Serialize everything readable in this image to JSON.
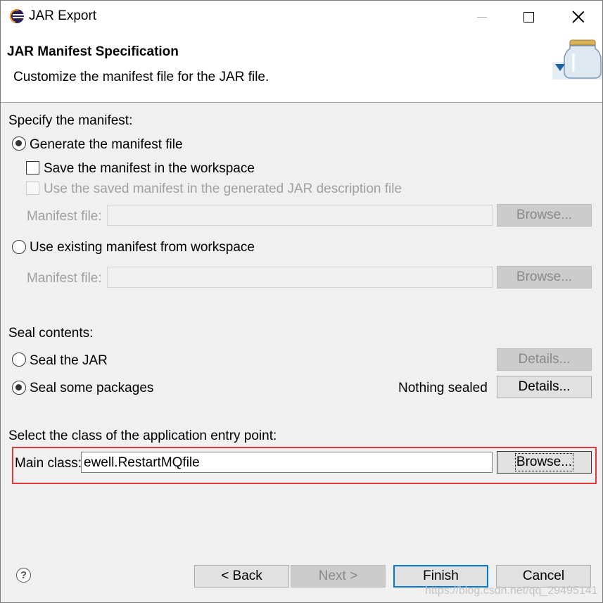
{
  "window": {
    "title": "JAR Export"
  },
  "banner": {
    "title": "JAR Manifest Specification",
    "description": "Customize the manifest file for the JAR file."
  },
  "manifest": {
    "section_label": "Specify the manifest:",
    "generate_label": "Generate the manifest file",
    "generate_checked": true,
    "save_label": "Save the manifest in the workspace",
    "save_checked": false,
    "use_saved_label": "Use the saved manifest in the generated JAR description file",
    "use_saved_enabled": false,
    "manifest_file_label": "Manifest file:",
    "manifest_file_value": "",
    "browse_label": "Browse...",
    "use_existing_label": "Use existing manifest from workspace",
    "use_existing_checked": false,
    "existing_manifest_file_label": "Manifest file:",
    "existing_manifest_file_value": "",
    "existing_browse_label": "Browse..."
  },
  "seal": {
    "section_label": "Seal contents:",
    "seal_jar_label": "Seal the JAR",
    "seal_jar_checked": false,
    "seal_jar_details_label": "Details...",
    "seal_some_label": "Seal some packages",
    "seal_some_checked": true,
    "status_text": "Nothing sealed",
    "seal_some_details_label": "Details..."
  },
  "entry_point": {
    "section_label": "Select the class of the application entry point:",
    "main_class_label": "Main class:",
    "main_class_value": "ewell.RestartMQfile",
    "browse_label": "Browse..."
  },
  "footer": {
    "help_icon": "?",
    "back_label": "< Back",
    "next_label": "Next >",
    "finish_label": "Finish",
    "cancel_label": "Cancel",
    "watermark": "https://blog.csdn.net/qq_29495141"
  },
  "colors": {
    "highlight_border": "#e0393e",
    "default_button_border": "#0078d7",
    "dialog_background": "#f0f0f0"
  },
  "icons": {
    "app": "eclipse-icon",
    "banner": "jar-icon",
    "help": "help-icon"
  }
}
